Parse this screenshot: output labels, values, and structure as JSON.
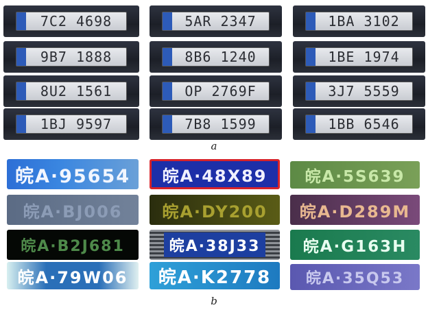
{
  "captions": {
    "a": "a",
    "b": "b"
  },
  "czech_plates": [
    "7C2 4698",
    "5AR 2347",
    "1BA 3102",
    "9B7 1888",
    "8B6 1240",
    "1BE 1974",
    "8U2 1561",
    "OP 2769F",
    "3J7 5559",
    "1BJ 9597",
    "7B8 1599",
    "1BB 6546"
  ],
  "chinese_plates": [
    "皖A·95654",
    "皖A·48X89",
    "皖A·5S639",
    "皖A·BJ006",
    "皖A·DY200",
    "皖A·D289M",
    "皖A·B2J681",
    "皖A·38J33",
    "皖A·G163H",
    "皖A·79W06",
    "皖A·K2778",
    "皖A·35Q53"
  ],
  "colors": {
    "cz_frame": "#22252d",
    "cz_plate": "#d8dbe0",
    "eu_strip": "#2d5bb8",
    "cn_background": "#1f4fb0",
    "cn_text": "#e8f0ff"
  }
}
